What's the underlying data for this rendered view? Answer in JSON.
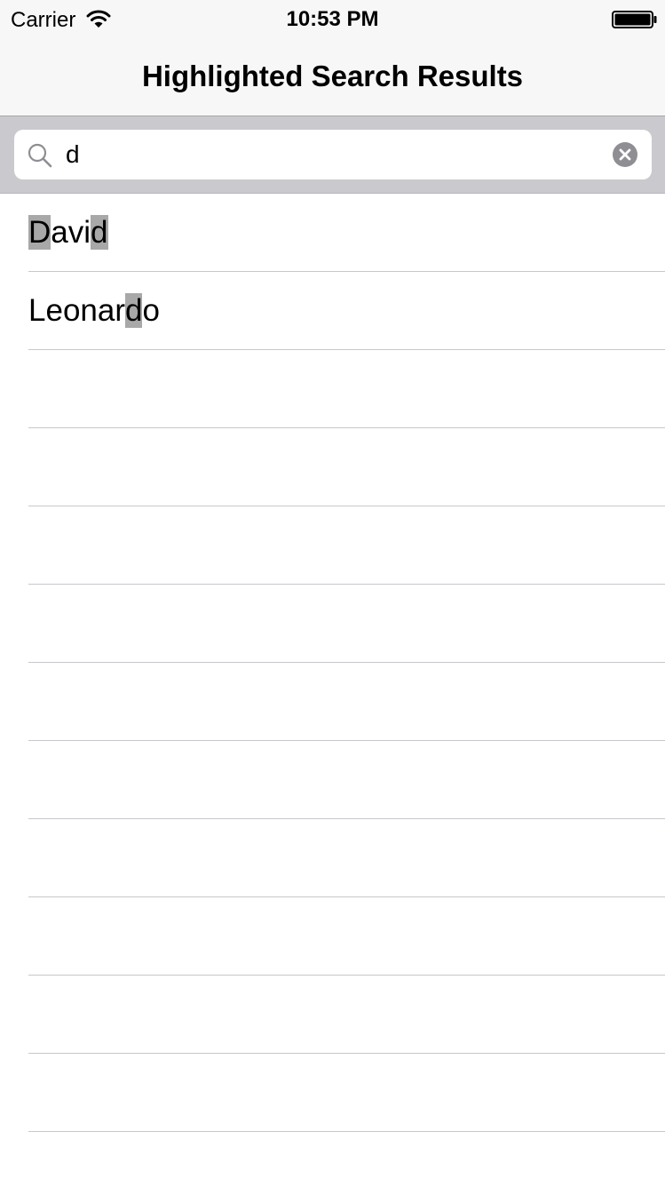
{
  "status_bar": {
    "carrier": "Carrier",
    "time": "10:53 PM",
    "wifi_icon": "wifi-icon",
    "battery_icon": "battery-icon"
  },
  "nav_bar": {
    "title": "Highlighted Search Results"
  },
  "search": {
    "query": "d",
    "search_icon": "search-icon",
    "clear_icon": "clear-circle-icon"
  },
  "colors": {
    "highlight": "#a8a8a8",
    "nav_background": "#f7f7f7",
    "search_bar_background": "#c9c9ce",
    "separator": "#c8c7cc"
  },
  "results": [
    {
      "name": "David",
      "highlighted_chars": [
        0,
        4
      ]
    },
    {
      "name": "Leonardo",
      "highlighted_chars": [
        6
      ]
    }
  ],
  "empty_rows": 10
}
